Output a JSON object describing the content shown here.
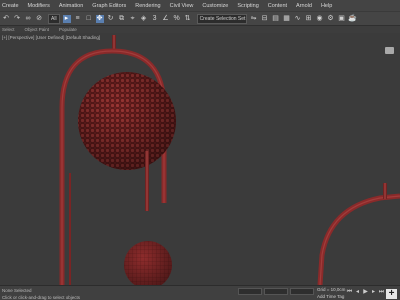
{
  "menu": [
    "Create",
    "Modifiers",
    "Animation",
    "Graph Editors",
    "Rendering",
    "Civil View",
    "Customize",
    "Scripting",
    "Content",
    "Arnold",
    "Help"
  ],
  "toolbar": {
    "selection_filter": "All",
    "named_selection": "Create Selection Set"
  },
  "ribbon": [
    "Select",
    "Object Paint",
    "Populate"
  ],
  "viewport": {
    "label": "[+] [Perspective] [User Defined] [Default Shading]",
    "colors": {
      "background": "#3b3b3b",
      "mesh": "#8a2a2a",
      "mesh_dark": "#5e1a1a",
      "mesh_highlight": "#b04a48"
    }
  },
  "statusbar": {
    "selection_info": "None Selected",
    "prompt": "Click or click-and-drag to select objects",
    "grid": "Grid = 10,0cm",
    "autokey": "Add Time Tag"
  }
}
